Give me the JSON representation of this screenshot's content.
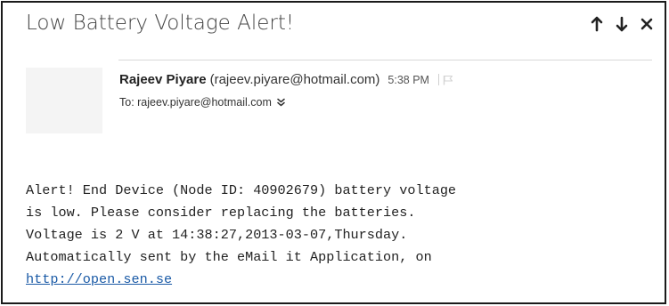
{
  "message": {
    "subject": "Low Battery Voltage Alert!",
    "sender_name": "Rajeev Piyare",
    "sender_email": "(rajeev.piyare@hotmail.com)",
    "sent_time": "5:38 PM",
    "to_line": "To: rajeev.piyare@hotmail.com",
    "body_lines": [
      "Alert! End Device (Node ID: 40902679) battery voltage",
      "is low. Please consider replacing the batteries.",
      "Voltage is 2 V at 14:38:27,2013-03-07,Thursday.",
      "Automatically sent by the eMail it Application, on"
    ],
    "body_link": "http://open.sen.se"
  },
  "icons": {
    "previous": "arrow-up-icon",
    "next": "arrow-down-icon",
    "close": "close-icon",
    "flag": "flag-icon",
    "expand": "double-chevron-down-icon"
  },
  "colors": {
    "link": "#1a5aa6",
    "frame_border": "#1a1a1a"
  }
}
